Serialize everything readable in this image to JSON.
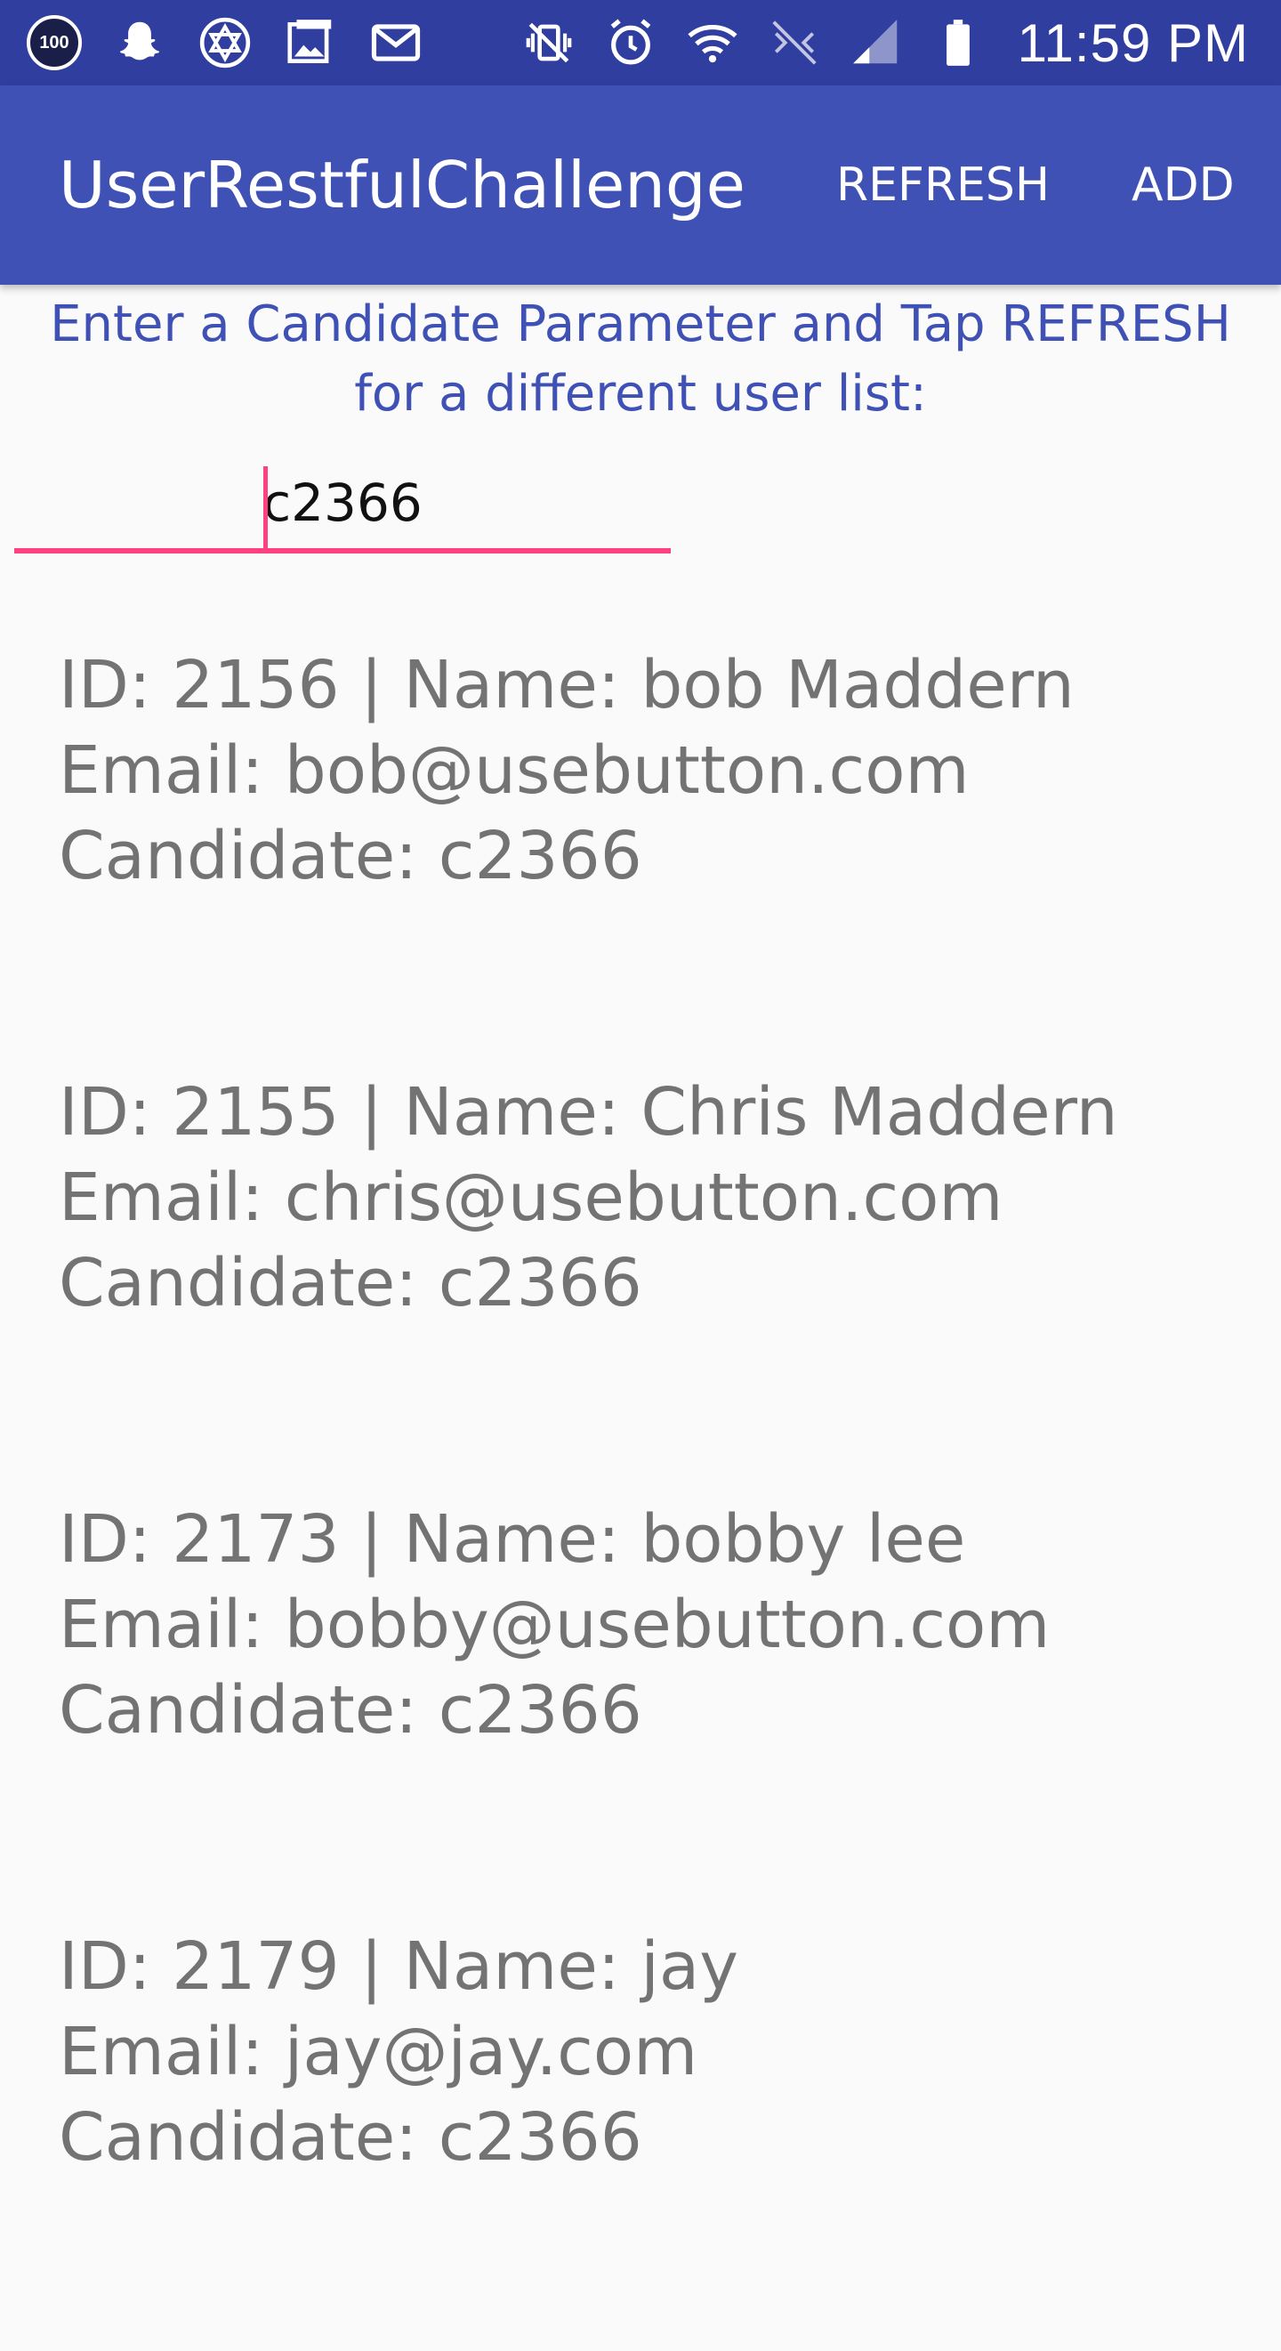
{
  "status_bar": {
    "time": "11:59 PM",
    "left_icons": [
      "hundred-badge-icon",
      "snapchat-ghost-icon",
      "star-of-david-icon",
      "photo-gallery-icon",
      "gmail-icon"
    ],
    "right_icons": [
      "vibrate-mute-icon",
      "alarm-icon",
      "wifi-icon",
      "lte-icon",
      "signal-icon",
      "battery-icon"
    ],
    "badge_text": "100"
  },
  "app_bar": {
    "title": "UserRestfulChallenge",
    "refresh_label": "REFRESH",
    "add_label": "ADD"
  },
  "instruction": {
    "text": "Enter a Candidate Parameter and Tap REFRESH for a different user list:"
  },
  "candidate_input": {
    "value": "c2366"
  },
  "users": [
    {
      "line1": "ID: 2156 | Name: bob Maddern",
      "line2": "Email: bob@usebutton.com",
      "line3": "Candidate: c2366"
    },
    {
      "line1": "ID: 2155 | Name: Chris Maddern",
      "line2": "Email: chris@usebutton.com",
      "line3": "Candidate: c2366"
    },
    {
      "line1": "ID: 2173 | Name: bobby lee",
      "line2": "Email: bobby@usebutton.com",
      "line3": "Candidate: c2366"
    },
    {
      "line1": "ID: 2179 | Name: jay",
      "line2": "Email: jay@jay.com",
      "line3": "Candidate: c2366"
    }
  ],
  "colors": {
    "status_bar": "#303f9f",
    "app_bar": "#3f51b5",
    "accent": "#ff4081",
    "list_text": "#737373",
    "background": "#fafafa"
  }
}
